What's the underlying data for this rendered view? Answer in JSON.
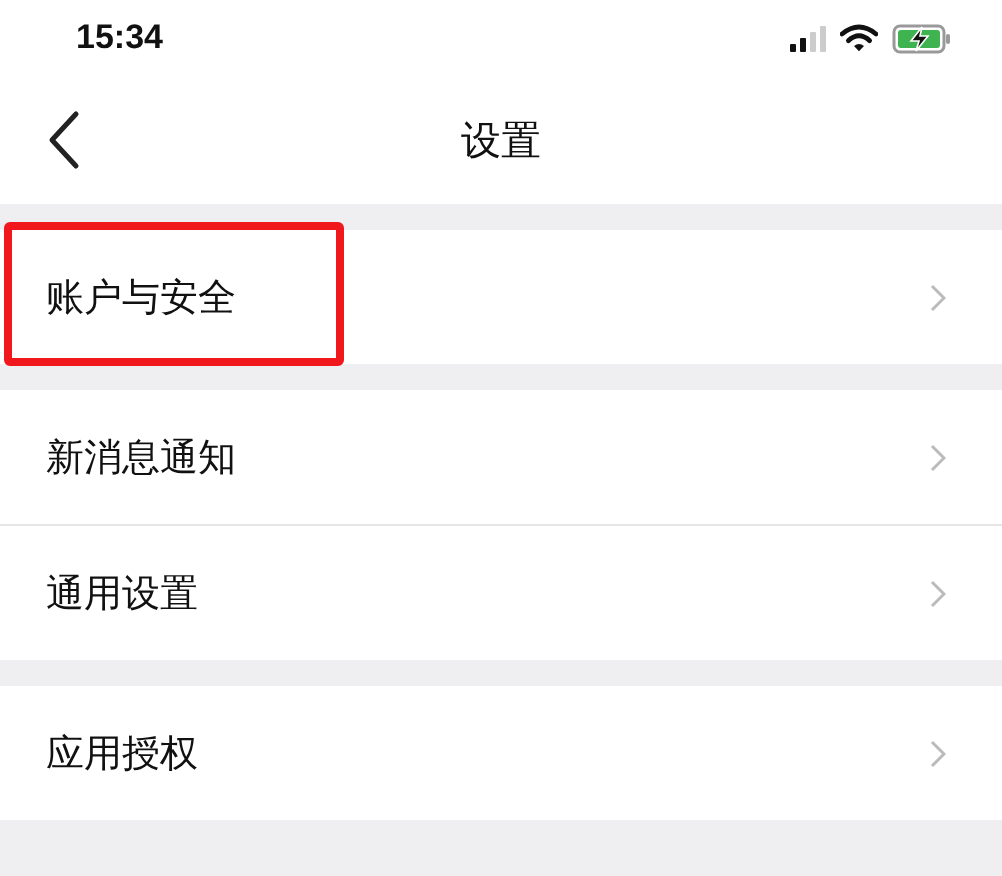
{
  "status_bar": {
    "time": "15:34",
    "charging": true
  },
  "nav": {
    "title": "设置"
  },
  "groups": [
    {
      "items": [
        {
          "label": "账户与安全",
          "highlighted": true
        }
      ]
    },
    {
      "items": [
        {
          "label": "新消息通知",
          "highlighted": false
        },
        {
          "label": "通用设置",
          "highlighted": false
        }
      ]
    },
    {
      "items": [
        {
          "label": "应用授权",
          "highlighted": false
        }
      ]
    }
  ]
}
